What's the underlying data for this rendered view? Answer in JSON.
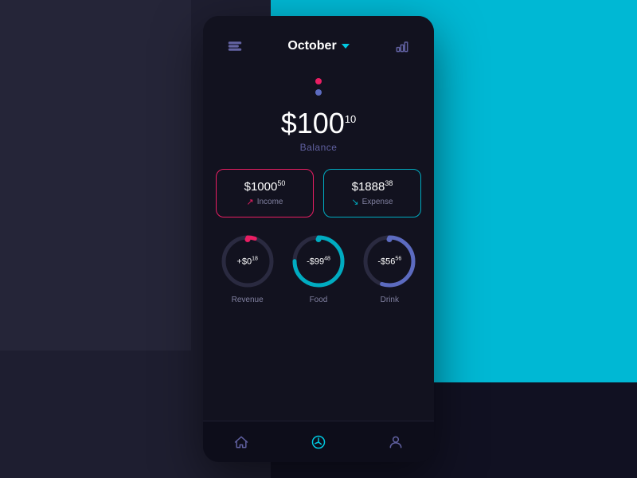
{
  "background": {
    "left_color": "#1e1e30",
    "right_color": "#00b8d4"
  },
  "header": {
    "title": "October",
    "menu_label": "menu",
    "chart_label": "chart"
  },
  "balance": {
    "main": "$100",
    "superscript": "10",
    "label": "Balance"
  },
  "income_card": {
    "amount": "$1000",
    "superscript": "50",
    "label": "Income",
    "arrow": "↗"
  },
  "expense_card": {
    "amount": "$1888",
    "superscript": "38",
    "label": "Expense",
    "arrow": "↘"
  },
  "circles": [
    {
      "id": "revenue",
      "value": "+$0",
      "superscript": "18",
      "label": "Revenue",
      "color": "#e91e63",
      "dot_color": "#e91e63",
      "percent": 5,
      "stroke_class": "circle-track-revenue"
    },
    {
      "id": "food",
      "value": "-$99",
      "superscript": "48",
      "label": "Food",
      "color": "#00acc1",
      "dot_color": "#00acc1",
      "percent": 75,
      "stroke_class": "circle-track-food"
    },
    {
      "id": "drink",
      "value": "-$56",
      "superscript": "56",
      "label": "Drink",
      "color": "#5c6bc0",
      "dot_color": "#5c6bc0",
      "percent": 55,
      "stroke_class": "circle-track-drink"
    }
  ],
  "nav": {
    "home_label": "Home",
    "chart_label": "Chart",
    "profile_label": "Profile"
  }
}
